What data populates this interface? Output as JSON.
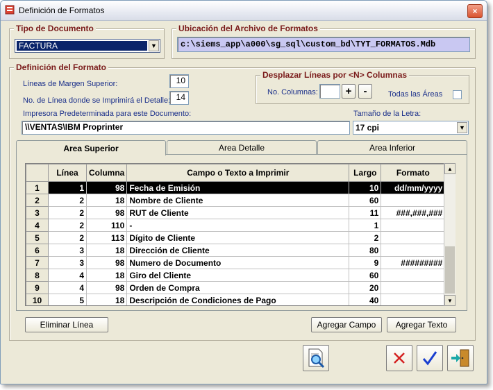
{
  "window": {
    "title": "Definición de Formatos",
    "close_glyph": "×"
  },
  "tipo_documento": {
    "legend": "Tipo de Documento",
    "selected": "FACTURA"
  },
  "ubicacion": {
    "legend": "Ubicación del Archivo de Formatos",
    "path": "c:\\siems_app\\a000\\sg_sql\\custom_bd\\TYT_FORMATOS.Mdb"
  },
  "definicion": {
    "legend": "Definición del Formato",
    "margen_label": "Líneas de Margen Superior:",
    "margen_value": "10",
    "detalle_label": "No. de Línea donde se Imprimirá el Detalle:",
    "detalle_value": "14",
    "impresora_label": "Impresora Predeterminada para este Documento:",
    "impresora_value": "\\\\VENTAS\\IBM Proprinter",
    "tamano_label": "Tamaño de la Letra:",
    "tamano_value": "17 cpi"
  },
  "desplazar": {
    "legend": "Desplazar Líneas por <N> Columnas",
    "columnas_label": "No. Columnas:",
    "columnas_value": "",
    "plus_label": "+",
    "minus_label": "-",
    "todas_label": "Todas las Áreas"
  },
  "tabs": [
    "Area Superior",
    "Area Detalle",
    "Area Inferior"
  ],
  "table": {
    "headers": [
      "Línea",
      "Columna",
      "Campo o Texto a Imprimir",
      "Largo",
      "Formato"
    ],
    "rows": [
      {
        "n": "1",
        "linea": "1",
        "columna": "98",
        "campo": "Fecha de Emisión",
        "largo": "10",
        "formato": "dd/mm/yyyy"
      },
      {
        "n": "2",
        "linea": "2",
        "columna": "18",
        "campo": "Nombre de Cliente",
        "largo": "60",
        "formato": ""
      },
      {
        "n": "3",
        "linea": "2",
        "columna": "98",
        "campo": "RUT de Cliente",
        "largo": "11",
        "formato": "###,###,###"
      },
      {
        "n": "4",
        "linea": "2",
        "columna": "110",
        "campo": "-",
        "largo": "1",
        "formato": ""
      },
      {
        "n": "5",
        "linea": "2",
        "columna": "113",
        "campo": "Dígito de Cliente",
        "largo": "2",
        "formato": ""
      },
      {
        "n": "6",
        "linea": "3",
        "columna": "18",
        "campo": "Dirección de Cliente",
        "largo": "80",
        "formato": ""
      },
      {
        "n": "7",
        "linea": "3",
        "columna": "98",
        "campo": "Numero de Documento",
        "largo": "9",
        "formato": "#########"
      },
      {
        "n": "8",
        "linea": "4",
        "columna": "18",
        "campo": "Giro del Cliente",
        "largo": "60",
        "formato": ""
      },
      {
        "n": "9",
        "linea": "4",
        "columna": "98",
        "campo": "Orden de Compra",
        "largo": "20",
        "formato": ""
      },
      {
        "n": "10",
        "linea": "5",
        "columna": "18",
        "campo": "Descripción de Condiciones de Pago",
        "largo": "40",
        "formato": ""
      }
    ]
  },
  "buttons": {
    "eliminar": "Eliminar Línea",
    "agregar_campo": "Agregar Campo",
    "agregar_texto": "Agregar Texto"
  },
  "colors": {
    "legend": "#7a1b1b",
    "label": "#1a2f8a",
    "path_bg": "#c9c8f2",
    "selection": "#0a246a"
  }
}
